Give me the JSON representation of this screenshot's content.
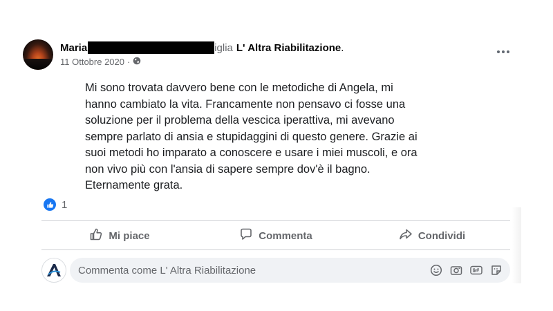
{
  "post": {
    "author_first": "Maria",
    "author_tail": "iglia",
    "page_name": "L' Altra Riabilitazione",
    "page_suffix": ".",
    "date": "11 Ottobre 2020",
    "meta_separator": "·",
    "privacy_icon": "globe-icon",
    "more_icon": "more-options-icon",
    "paragraph_lines": [
      "Mi sono trovata davvero bene con le metodiche di Angela, mi",
      "hanno cambiato la vita. Francamente non pensavo ci fosse una",
      "soluzione per il problema della vescica iperattiva, mi avevano",
      "sempre parlato di ansia e stupidaggini di questo genere. Grazie ai",
      "suoi metodi ho imparato a conoscere e usare i miei muscoli, e ora",
      "non vivo più con l'ansia di sapere sempre dov'è il bagno.",
      "Eternamente grata."
    ]
  },
  "reactions": {
    "icon": "like-reaction-icon",
    "count": "1"
  },
  "actions": {
    "like_label": "Mi piace",
    "comment_label": "Commenta",
    "share_label": "Condividi"
  },
  "comment": {
    "placeholder": "Commenta come L' Altra Riabilitazione",
    "icons": [
      "emoji-icon",
      "camera-icon",
      "gif-icon",
      "sticker-icon"
    ]
  },
  "colors": {
    "accent": "#1877f2",
    "secondary_text": "#65676b",
    "divider": "#ced0d4",
    "input_bg": "#f0f2f5"
  }
}
